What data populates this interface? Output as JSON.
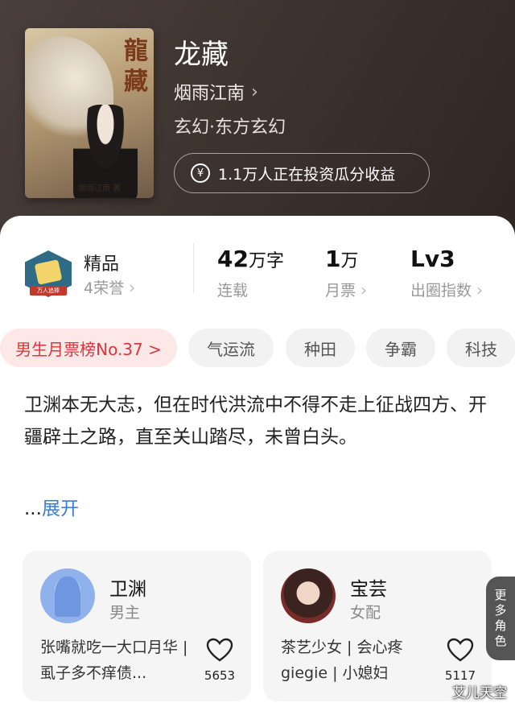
{
  "book": {
    "title": "龙藏",
    "author": "烟雨江南",
    "genre": "玄幻·东方玄幻",
    "cover_title": "龍藏",
    "cover_author": "烟雨江南 著",
    "invest_text": "1.1万人正在投资瓜分收益"
  },
  "stats": {
    "quality_label": "精品",
    "honors": "4荣誉",
    "badge_text": "万人追捧",
    "words_value": "42",
    "words_unit": "万字",
    "words_sub": "连载",
    "votes_value": "1",
    "votes_unit": "万",
    "votes_sub": "月票",
    "level_value": "Lv3",
    "level_sub": "出圈指数"
  },
  "tags": [
    "男生月票榜No.37 >",
    "气运流",
    "种田",
    "争霸",
    "科技"
  ],
  "description": "卫渊本无大志，但在时代洪流中不得不走上征战四方、开疆辟土之路，直至关山踏尽，未曾白头。",
  "more_link": {
    "dots": "...",
    "label": "展开"
  },
  "characters": [
    {
      "name": "卫渊",
      "role": "男主",
      "desc": "张嘴就吃一大口月华 | 虱子多不痒债...",
      "likes": "5653"
    },
    {
      "name": "宝芸",
      "role": "女配",
      "desc": "茶艺少女 | 会心疼giegie | 小媳妇",
      "likes": "5117"
    }
  ],
  "more_roles": [
    "更",
    "多",
    "角",
    "色"
  ],
  "watermark": "艾儿天空",
  "colors": {
    "accent_blue": "#3b7dd8",
    "rank_red": "#d9363e"
  }
}
